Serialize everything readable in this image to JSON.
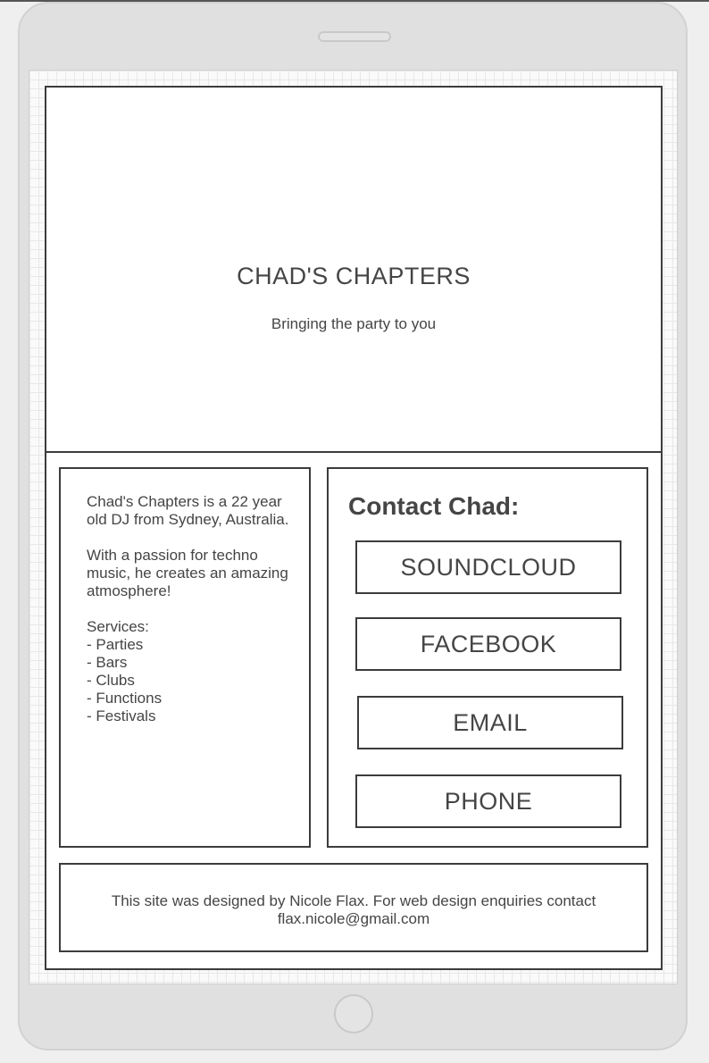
{
  "hero": {
    "title": "CHAD'S CHAPTERS",
    "tagline": "Bringing the party to you"
  },
  "about": {
    "intro": "Chad's Chapters is a 22 year old DJ from Sydney, Australia.",
    "passion": "With a passion for techno music, he creates an amazing atmosphere!",
    "services_heading": "Services:",
    "services": [
      "- Parties",
      "- Bars",
      "- Clubs",
      "- Functions",
      "- Festivals"
    ]
  },
  "contact": {
    "heading": "Contact Chad:",
    "buttons": [
      "SOUNDCLOUD",
      "FACEBOOK",
      "EMAIL",
      "PHONE"
    ]
  },
  "footer": {
    "text": "This site was designed by Nicole Flax. For web design enquiries contact flax.nicole@gmail.com"
  }
}
